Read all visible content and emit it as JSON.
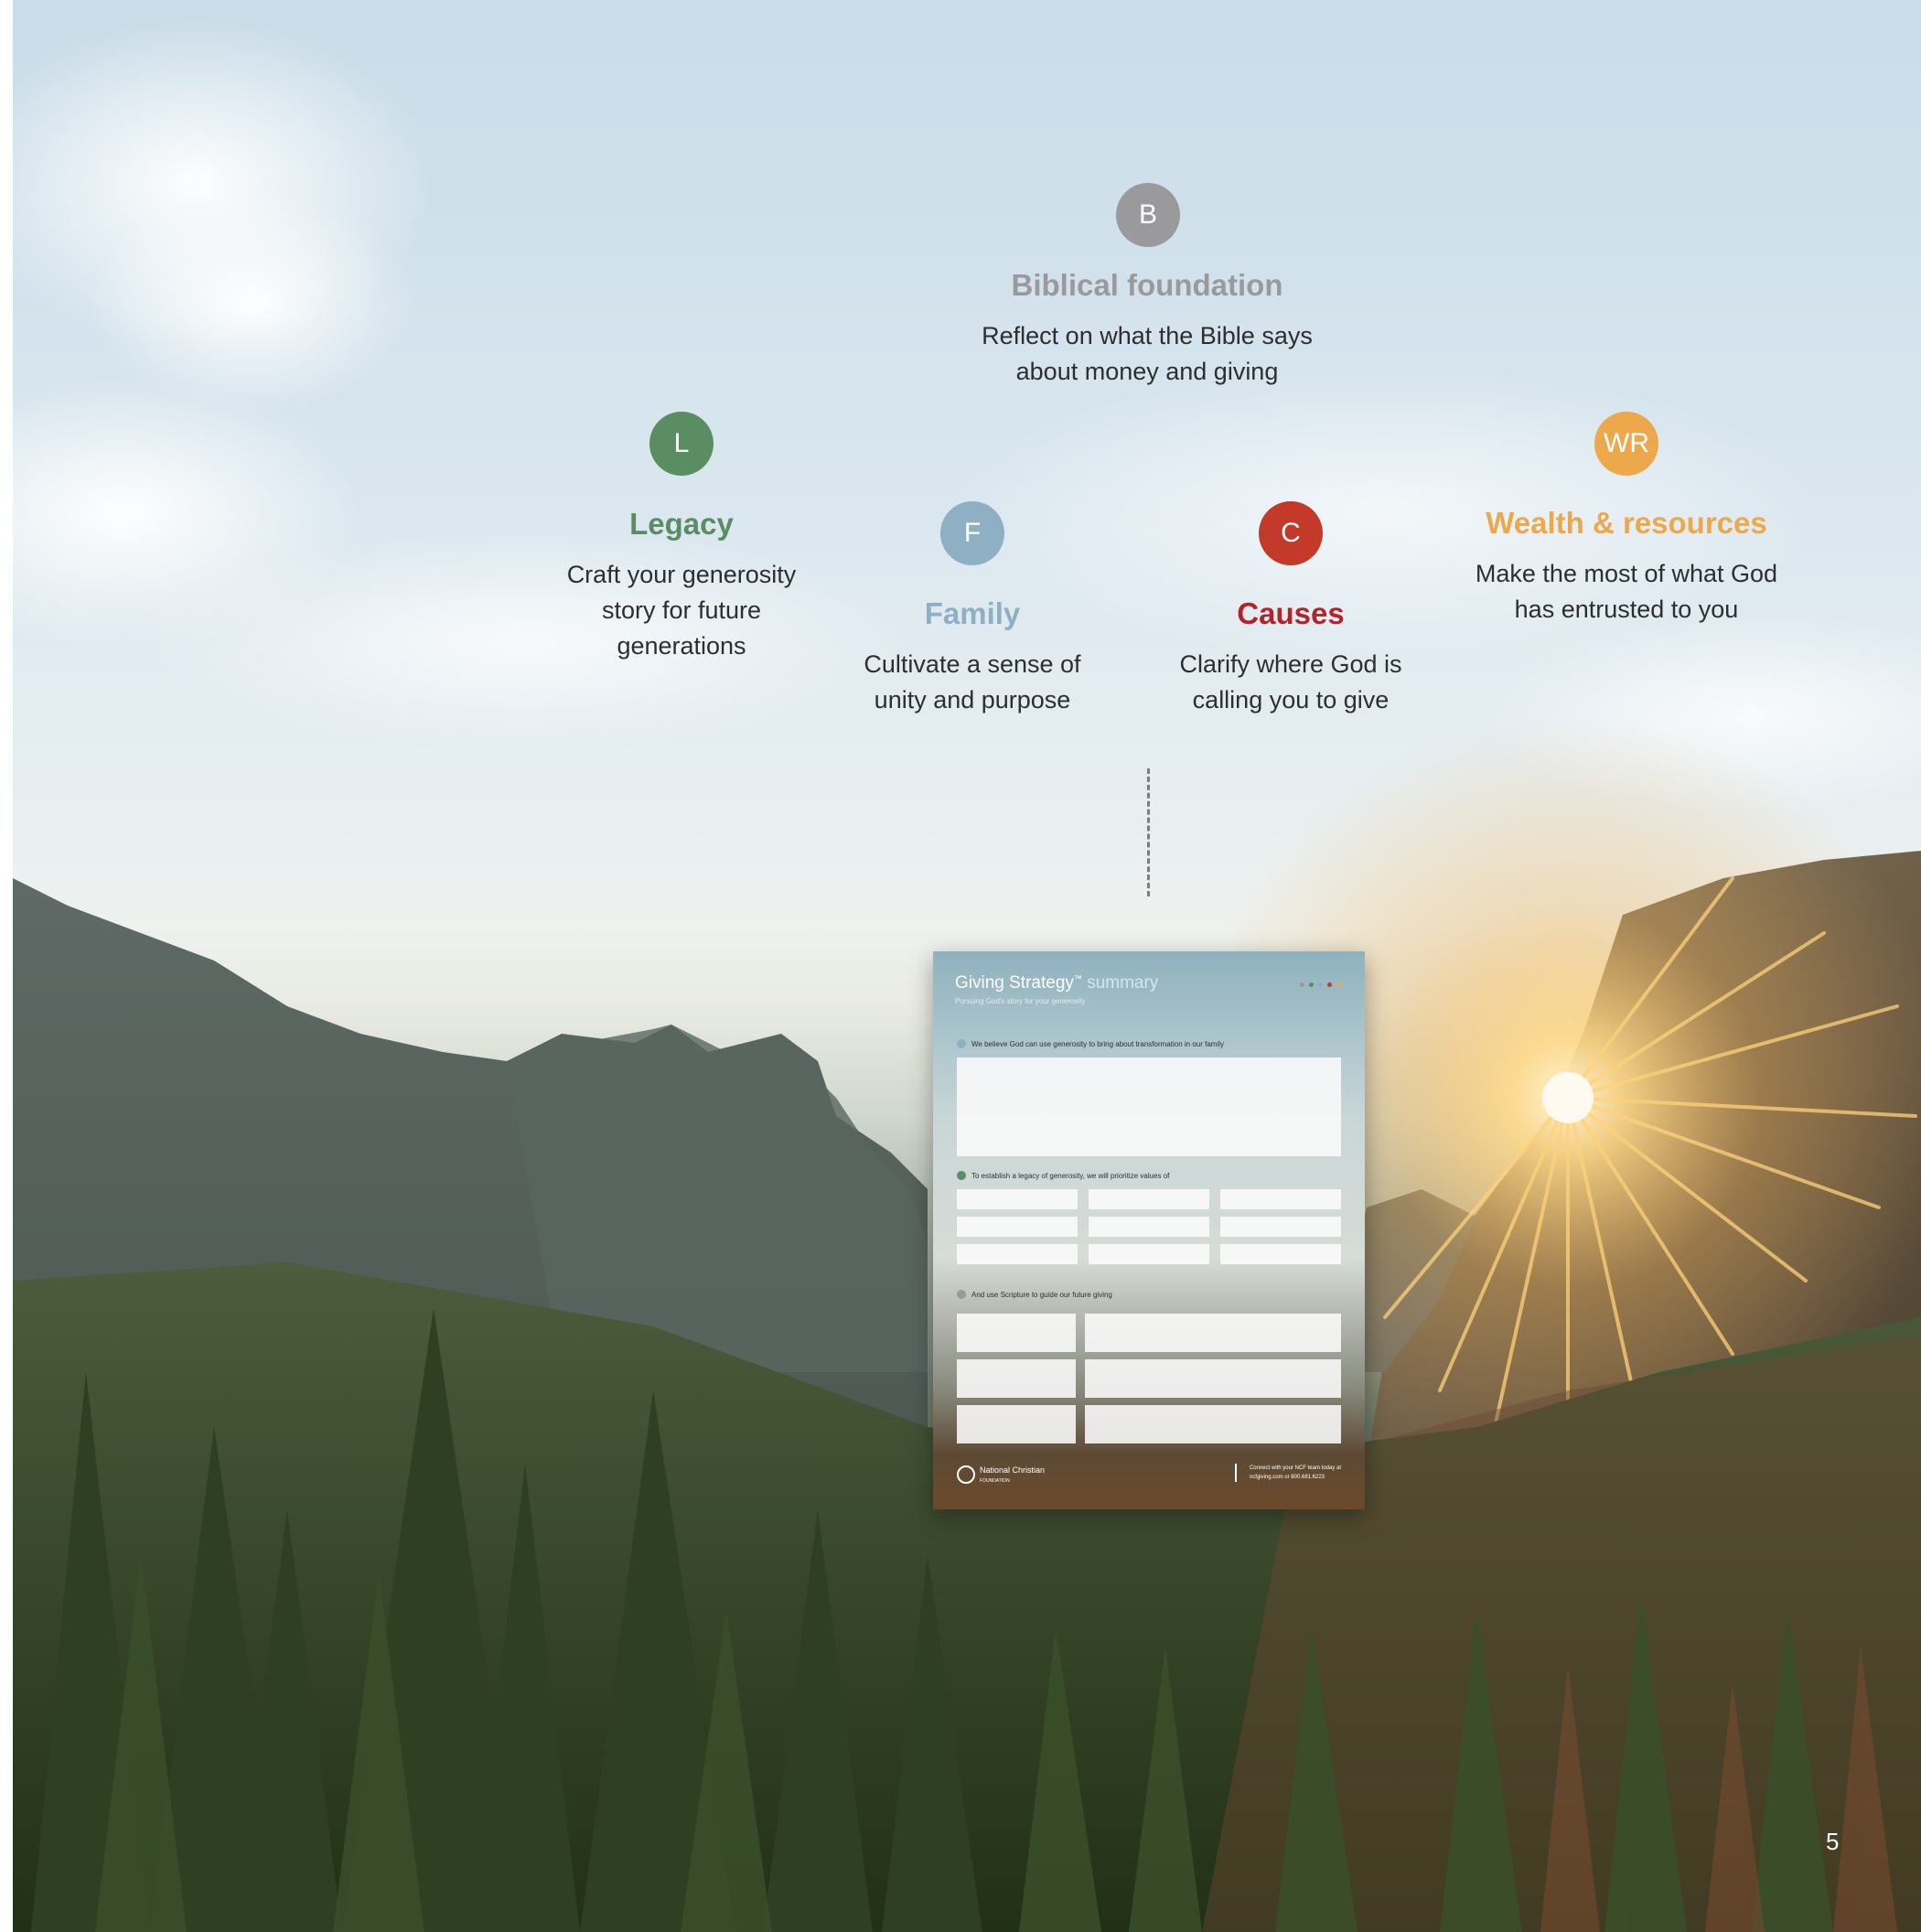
{
  "steps": {
    "biblical": {
      "badge": "B",
      "title": "Biblical foundation",
      "desc": "Reflect on what the Bible says\nabout money and giving",
      "color": "#9a9a9c"
    },
    "legacy": {
      "badge": "L",
      "title": "Legacy",
      "desc": "Craft your generosity\nstory for future\ngenerations",
      "color": "#5a8e62"
    },
    "family": {
      "badge": "F",
      "title": "Family",
      "desc": "Cultivate a sense of\nunity and purpose",
      "color": "#8fb0c4"
    },
    "causes": {
      "badge": "C",
      "title": "Causes",
      "desc": "Clarify where God is\ncalling you to give",
      "color": "#c43a2a"
    },
    "wealth": {
      "badge": "WR",
      "title": "Wealth & resources",
      "desc": "Make the most of what God\nhas entrusted to you",
      "color": "#eea84c"
    }
  },
  "summary": {
    "title": "Giving Strategy",
    "trademark": "™",
    "title_suffix": "summary",
    "subtitle": "Pursuing God's story for your generosity",
    "q1": "We believe God can use generosity to bring about transformation in our family",
    "q2": "To establish a legacy of generosity, we will prioritize values of",
    "q3": "And use Scripture to guide our future giving",
    "logo": "National Christian",
    "logo_sub": "FOUNDATION",
    "contact_line1": "Connect with your NCF team today at",
    "contact_line2": "ncfgiving.com or 800.681.6223"
  },
  "page_number": "5"
}
